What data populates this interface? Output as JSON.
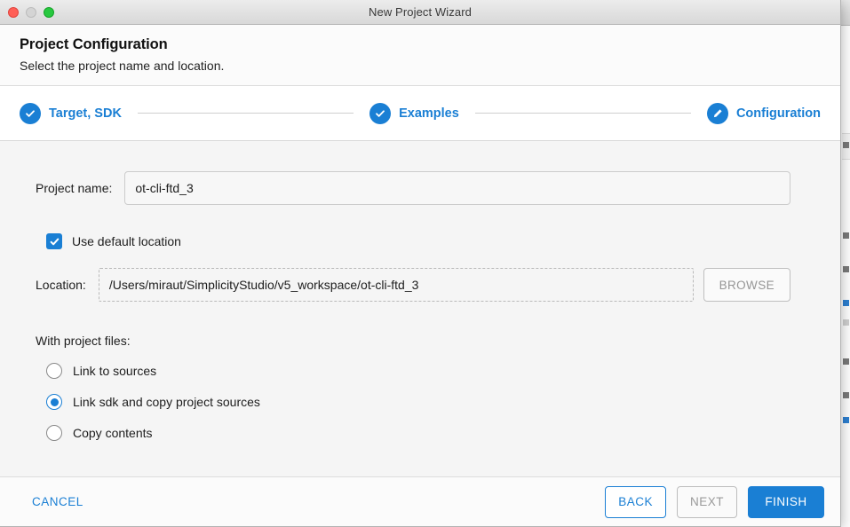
{
  "window": {
    "title": "New Project Wizard",
    "controls": {
      "close": "close-button",
      "minimize": "minimize-button",
      "maximize": "maximize-button"
    }
  },
  "header": {
    "title": "Project Configuration",
    "subtitle": "Select the project name and location."
  },
  "stepper": {
    "steps": [
      {
        "label": "Target, SDK",
        "icon": "check-icon",
        "state": "completed"
      },
      {
        "label": "Examples",
        "icon": "check-icon",
        "state": "completed"
      },
      {
        "label": "Configuration",
        "icon": "pencil-icon",
        "state": "current"
      }
    ]
  },
  "form": {
    "project_name": {
      "label": "Project name:",
      "value": "ot-cli-ftd_3",
      "placeholder": "Project name"
    },
    "use_default_location": {
      "label": "Use default location",
      "checked": true
    },
    "location": {
      "label": "Location:",
      "value": "/Users/miraut/SimplicityStudio/v5_workspace/ot-cli-ftd_3",
      "placeholder": "Location",
      "enabled": false
    },
    "browse_label": "BROWSE",
    "project_files": {
      "title": "With project files:",
      "options": [
        {
          "label": "Link to sources",
          "selected": false
        },
        {
          "label": "Link sdk and copy project sources",
          "selected": true
        },
        {
          "label": "Copy contents",
          "selected": false
        }
      ]
    }
  },
  "footer": {
    "cancel_label": "CANCEL",
    "back_label": "BACK",
    "next_label": "NEXT",
    "finish_label": "FINISH"
  },
  "colors": {
    "accent": "#1a7fd4",
    "body_bg": "#f5f5f5",
    "panel_bg": "#fbfbfb",
    "text": "#1d1d1d",
    "disabled_text": "#9a9a9a",
    "close_dot": "#ff5f57",
    "minimize_dot": "#d4d4d4",
    "maximize_dot": "#28c840"
  }
}
